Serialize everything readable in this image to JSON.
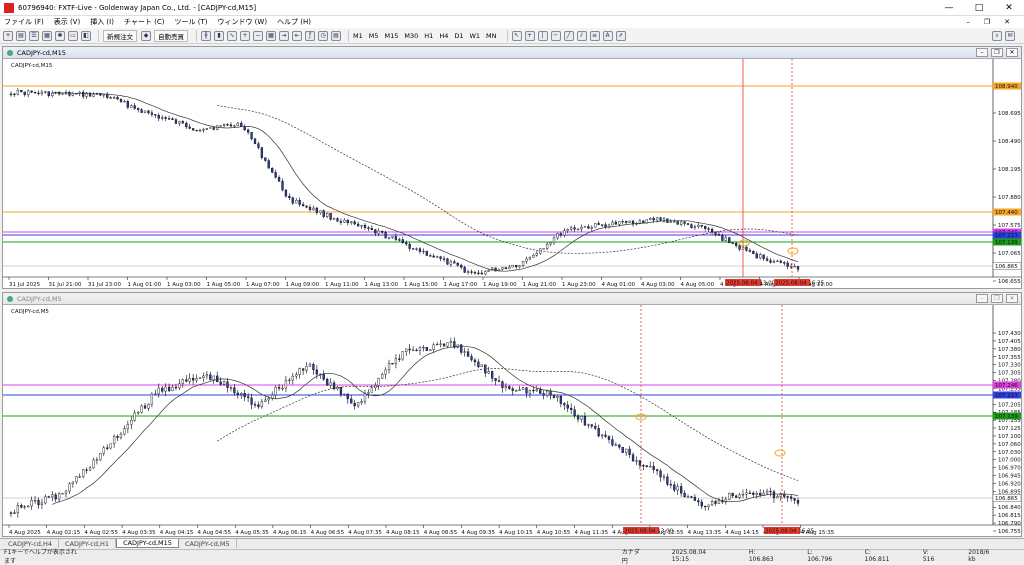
{
  "window": {
    "title": "60796940: FXTF-Live - Goldenway Japan Co., Ltd. - [CADJPY-cd,M15]",
    "controls": [
      "—",
      "□",
      "✕"
    ]
  },
  "menu": [
    "ファイル (F)",
    "表示 (V)",
    "挿入 (I)",
    "チャート (C)",
    "ツール (T)",
    "ウィンドウ (W)",
    "ヘルプ (H)"
  ],
  "toolbar": {
    "new_order": "新規注文",
    "auto_trade": "自動売買",
    "timeframes": [
      "M1",
      "M5",
      "M15",
      "M30",
      "H1",
      "H4",
      "D1",
      "W1",
      "MN"
    ]
  },
  "colors": {
    "bull": "#ffffff",
    "bear": "#2b3fa0",
    "red_line": "#e63b2e",
    "orange": "#f5a623",
    "magenta": "#e040e0",
    "blue": "#3040e0",
    "green": "#18a018"
  },
  "charts": [
    {
      "header": "CADJPY-cd,M15",
      "inner_label": "CADJPY-cd,M15",
      "price_labels": [
        "108.945",
        "108.695",
        "108.490",
        "108.195",
        "107.880",
        "107.575",
        "107.065",
        "106.655"
      ],
      "tag_labels": {
        "orange1": "108.940",
        "orange2": "107.440",
        "magenta": "107.246",
        "blue": "107.213",
        "green": "107.139",
        "last": "106.865"
      },
      "time_labels": [
        "31 Jul 2025",
        "31 Jul 21:00",
        "31 Jul 23:00",
        "1 Aug 01:00",
        "1 Aug 03:00",
        "1 Aug 05:00",
        "1 Aug 07:00",
        "1 Aug 09:00",
        "1 Aug 11:00",
        "1 Aug 13:00",
        "1 Aug 15:00",
        "1 Aug 17:00",
        "1 Aug 19:00",
        "1 Aug 21:00",
        "1 Aug 23:00",
        "4 Aug 01:00",
        "4 Aug 03:00",
        "4 Aug 05:00",
        "4 Aug 07:00",
        "4 Aug 09:00",
        "4 Aug 11:00"
      ],
      "red_time_labels": [
        "2025.08.04 13:00",
        "2025.08.04 16:35"
      ]
    },
    {
      "header": "CADJPY-cd,M5",
      "inner_label": "CADJPY-cd,M5",
      "price_labels": [
        "107.430",
        "107.405",
        "107.380",
        "107.355",
        "107.330",
        "107.305",
        "107.280",
        "107.255",
        "107.230",
        "107.205",
        "107.185",
        "107.155",
        "107.125",
        "107.100",
        "107.060",
        "107.030",
        "107.000",
        "106.970",
        "106.945",
        "106.920",
        "106.895",
        "106.865",
        "106.840",
        "106.815",
        "106.790",
        "106.755"
      ],
      "tag_labels": {
        "magenta": "107.246",
        "blue": "107.213",
        "green": "107.139",
        "last": "106.865"
      },
      "time_labels": [
        "4 Aug 2025",
        "4 Aug 02:15",
        "4 Aug 02:55",
        "4 Aug 03:35",
        "4 Aug 04:15",
        "4 Aug 04:55",
        "4 Aug 05:35",
        "4 Aug 06:15",
        "4 Aug 06:55",
        "4 Aug 07:35",
        "4 Aug 08:15",
        "4 Aug 08:55",
        "4 Aug 09:35",
        "4 Aug 10:15",
        "4 Aug 10:55",
        "4 Aug 11:35",
        "4 Aug 12:15",
        "4 Aug 12:55",
        "4 Aug 13:35",
        "4 Aug 14:15",
        "4 Aug 14:55",
        "4 Aug 15:35"
      ],
      "red_time_labels": [
        "2025.08.04 13:00",
        "2025.08.04 16:35"
      ]
    }
  ],
  "tabs": [
    "CADJPY-cd,H4",
    "CADJPY-cd,H1",
    "CADJPY-cd,M15",
    "CADJPY-cd,M5"
  ],
  "active_tab": "CADJPY-cd,M15",
  "status": {
    "help": "F1キーでヘルプが表示されます",
    "profile": "カナダ円",
    "time": "2025.08.04 15:15",
    "open": "H: 106.863",
    "low": "L: 106.796",
    "close": "C: 106.811",
    "volume": "V: 516",
    "traffic": "2018/6 kb"
  }
}
